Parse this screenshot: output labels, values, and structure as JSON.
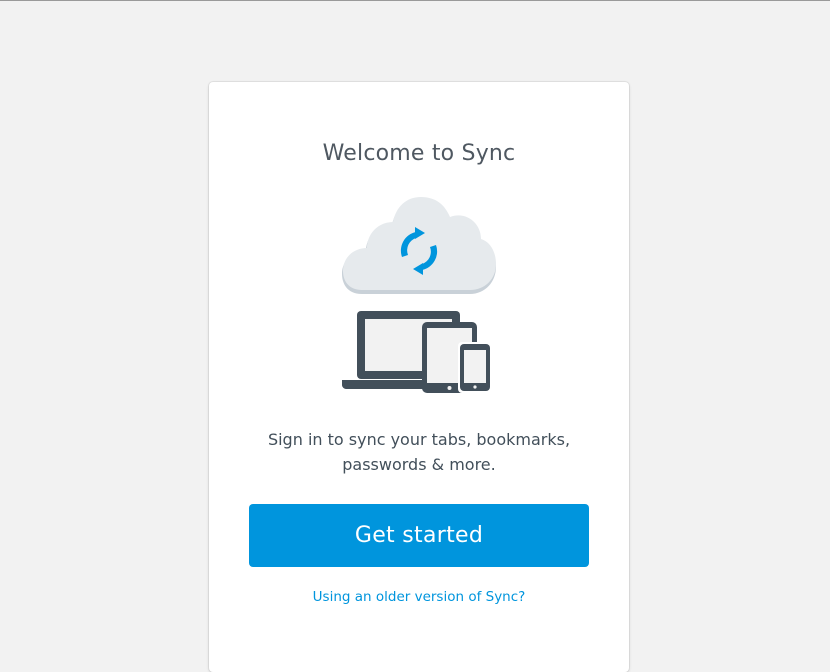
{
  "colors": {
    "page_background": "#f2f2f2",
    "card_background": "#ffffff",
    "accent": "#0095dd",
    "title_text": "#4f5861",
    "body_text": "#424f5a",
    "device_dark": "#424f5a",
    "cloud": "#e6eaed"
  },
  "card": {
    "title": "Welcome to Sync",
    "illustration": {
      "icons": [
        "cloud-icon",
        "sync-arrows-icon",
        "laptop-icon",
        "tablet-icon",
        "phone-icon"
      ]
    },
    "message_line1": "Sign in to sync your tabs, bookmarks,",
    "message_line2": "passwords & more.",
    "primary_button_label": "Get started",
    "secondary_link_label": "Using an older version of Sync?"
  }
}
